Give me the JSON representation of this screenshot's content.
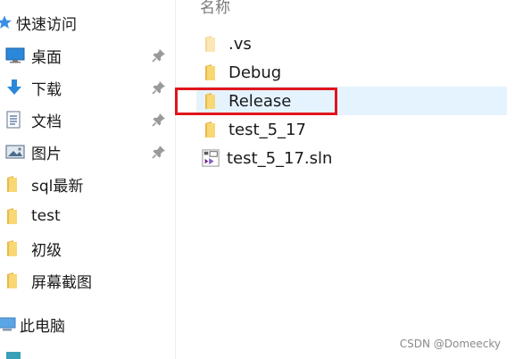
{
  "sidebar": {
    "quick_access_label": "快速访问",
    "items": [
      {
        "label": "桌面",
        "icon": "desktop-icon",
        "pinned": true
      },
      {
        "label": "下载",
        "icon": "download-icon",
        "pinned": true
      },
      {
        "label": "文档",
        "icon": "document-icon",
        "pinned": true
      },
      {
        "label": "图片",
        "icon": "picture-icon",
        "pinned": true
      },
      {
        "label": "sql最新",
        "icon": "folder-icon",
        "pinned": false
      },
      {
        "label": "test",
        "icon": "folder-icon",
        "pinned": false
      },
      {
        "label": "初级",
        "icon": "folder-icon",
        "pinned": false
      },
      {
        "label": "屏幕截图",
        "icon": "folder-icon",
        "pinned": false
      }
    ],
    "this_pc_label": "此电脑"
  },
  "main": {
    "column_header": "名称",
    "files": [
      {
        "name": ".vs",
        "icon": "folder-icon-light",
        "selected": false
      },
      {
        "name": "Debug",
        "icon": "folder-icon",
        "selected": false
      },
      {
        "name": "Release",
        "icon": "folder-icon",
        "selected": true
      },
      {
        "name": "test_5_17",
        "icon": "folder-icon",
        "selected": false
      },
      {
        "name": "test_5_17.sln",
        "icon": "visual-studio-solution-icon",
        "selected": false
      }
    ]
  },
  "annotation": {
    "highlight_color": "#e0151b",
    "highlighted_item": "Release"
  },
  "watermark": "CSDN @Domeecky",
  "colors": {
    "folder": "#f8d775",
    "selection": "#e5f3ff",
    "text": "#1a1a1a"
  }
}
